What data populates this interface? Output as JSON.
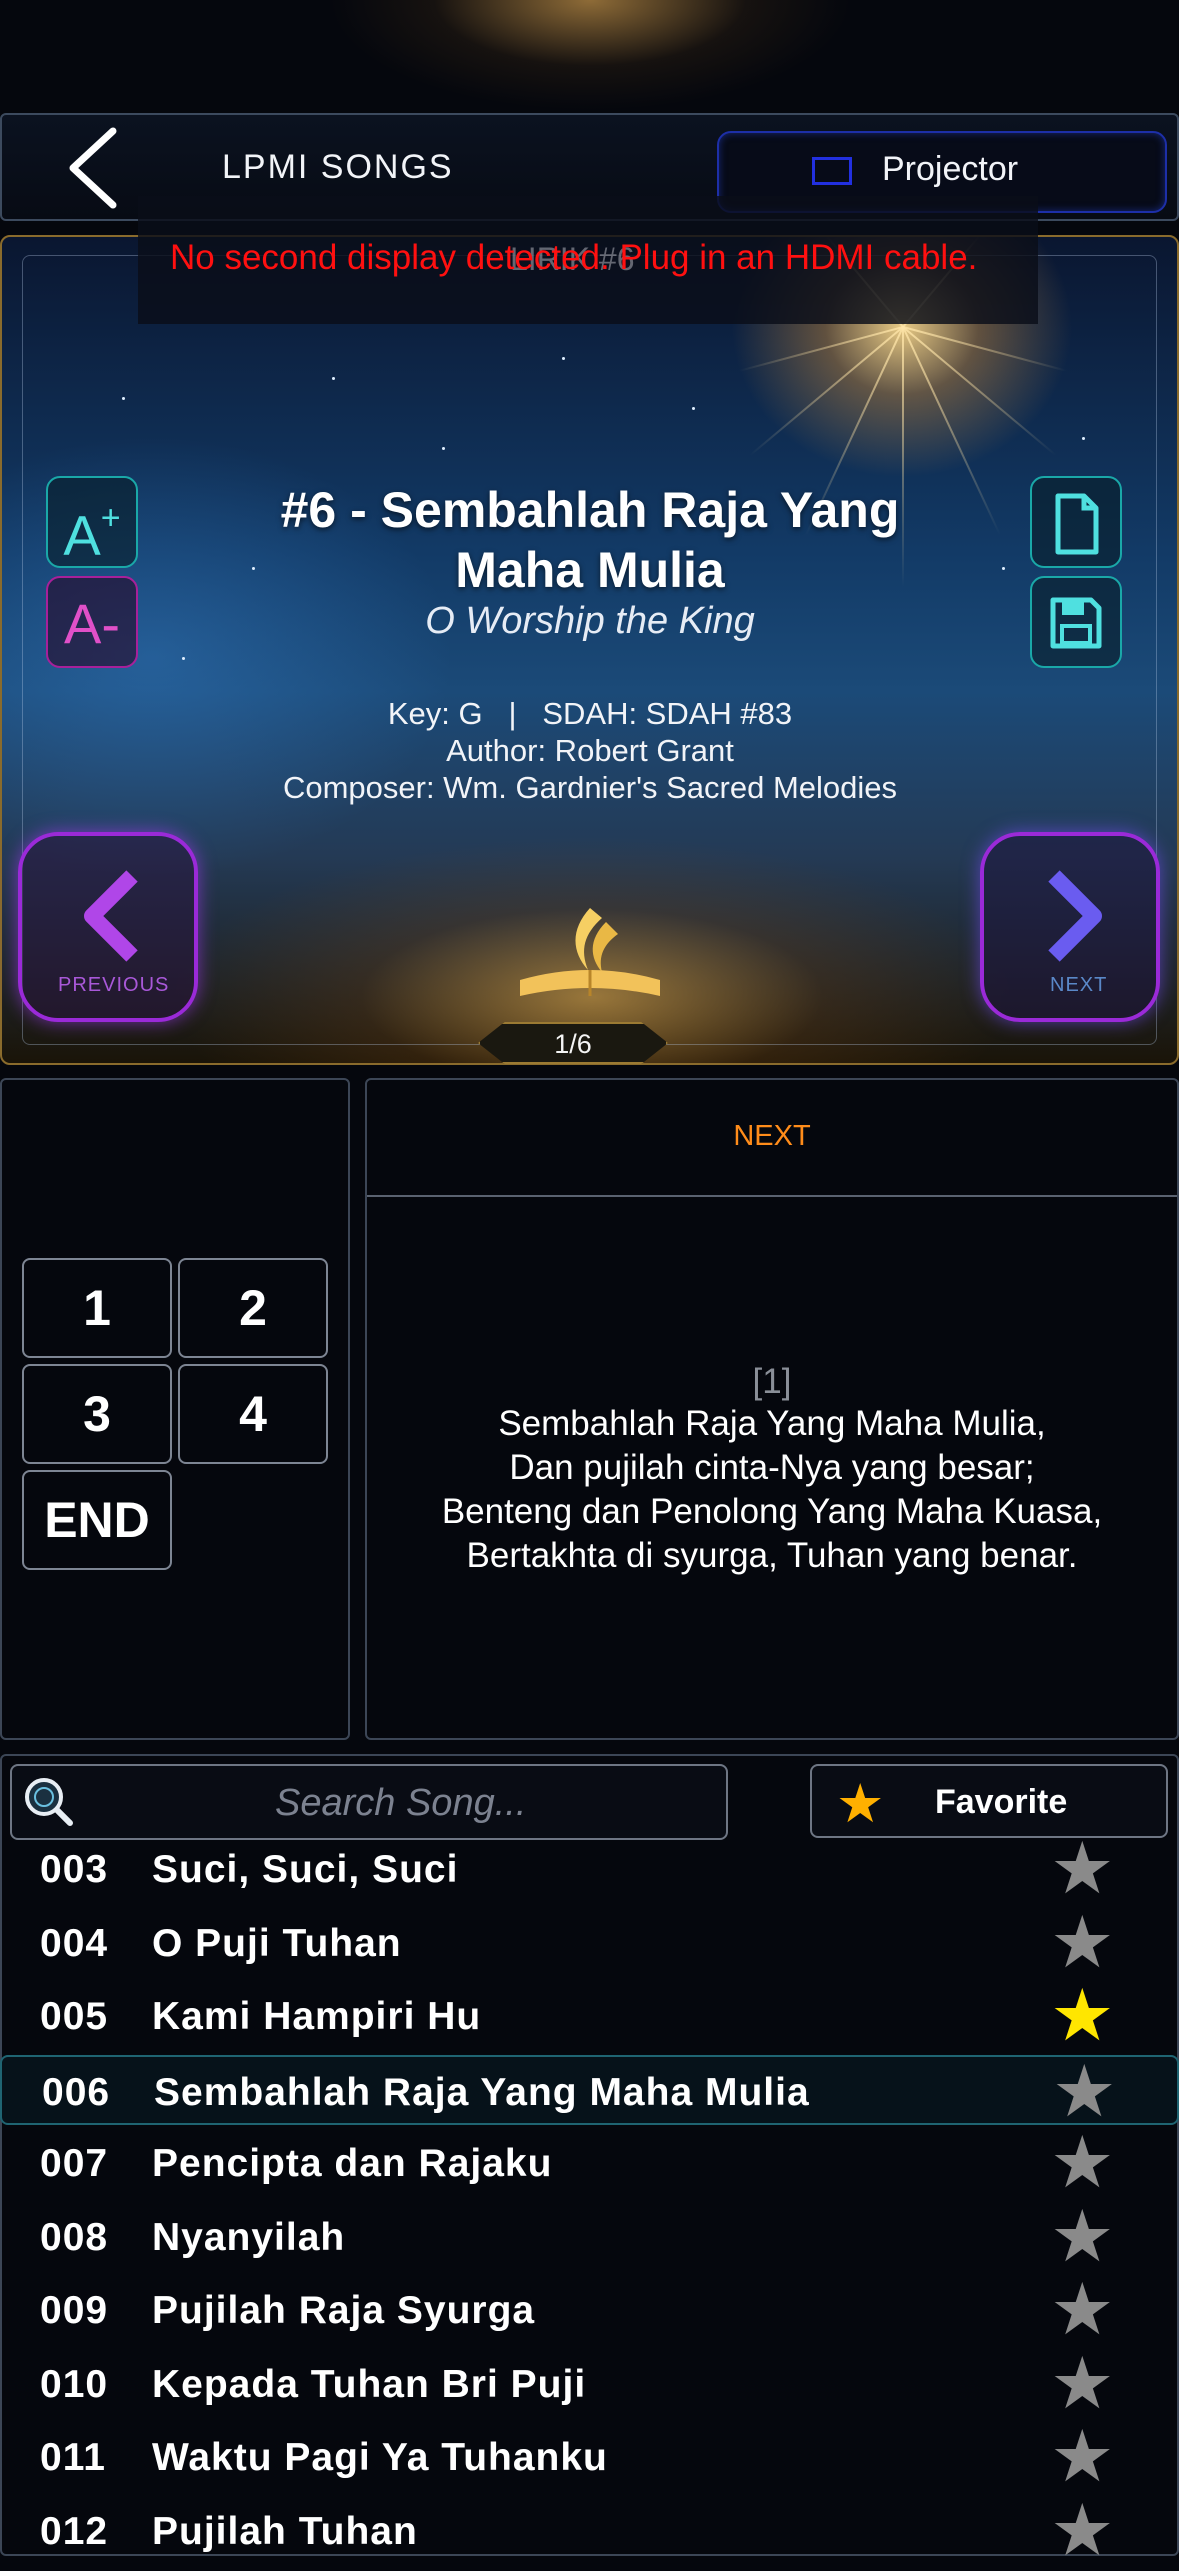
{
  "header": {
    "title": "LPMI SONGS",
    "projector_label": "Projector"
  },
  "hero": {
    "faint_label": "LIRIK #6",
    "warning": "No second display detected. Plug in an HDMI cable.",
    "font_increase": "A",
    "font_decrease": "A-",
    "song_title_line1": "#6 - Sembahlah Raja Yang",
    "song_title_line2": "Maha Mulia",
    "song_subtitle": "O Worship the King",
    "key_line": "Key: G   |   SDAH: SDAH #83",
    "author_line": "Author: Robert Grant",
    "composer_line": "Composer: Wm. Gardnier's Sacred Melodies",
    "prev_label": "PREVIOUS",
    "next_label": "NEXT",
    "page_indicator": "1/6"
  },
  "verses": {
    "buttons": [
      "1",
      "2",
      "3",
      "4",
      "END"
    ]
  },
  "preview": {
    "next_label": "NEXT",
    "verse_number": "[1]",
    "lines": [
      "Sembahlah Raja Yang Maha Mulia,",
      "Dan pujilah cinta-Nya yang besar;",
      "Benteng dan Penolong Yang Maha Kuasa,",
      "Bertakhta di syurga, Tuhan yang benar."
    ]
  },
  "search": {
    "placeholder": "Search Song...",
    "favorite_label": "Favorite"
  },
  "songs": [
    {
      "num": "003",
      "title": "Suci, Suci, Suci",
      "favorite": false
    },
    {
      "num": "004",
      "title": "O Puji Tuhan",
      "favorite": false
    },
    {
      "num": "005",
      "title": "Kami Hampiri Hu",
      "favorite": true
    },
    {
      "num": "006",
      "title": "Sembahlah Raja Yang Maha Mulia",
      "favorite": false,
      "selected": true
    },
    {
      "num": "007",
      "title": "Pencipta dan Rajaku",
      "favorite": false
    },
    {
      "num": "008",
      "title": "Nyanyilah",
      "favorite": false
    },
    {
      "num": "009",
      "title": "Pujilah Raja Syurga",
      "favorite": false
    },
    {
      "num": "010",
      "title": "Kepada Tuhan Bri Puji",
      "favorite": false
    },
    {
      "num": "011",
      "title": "Waktu Pagi Ya Tuhanku",
      "favorite": false
    },
    {
      "num": "012",
      "title": "Pujilah Tuhan",
      "favorite": false
    }
  ],
  "colors": {
    "accent_orange": "#ff8c1a",
    "warning_red": "#ff1010",
    "favorite_yellow": "#ffe600",
    "star_gray": "#8a8a8a",
    "selected_border": "#1f6472"
  }
}
